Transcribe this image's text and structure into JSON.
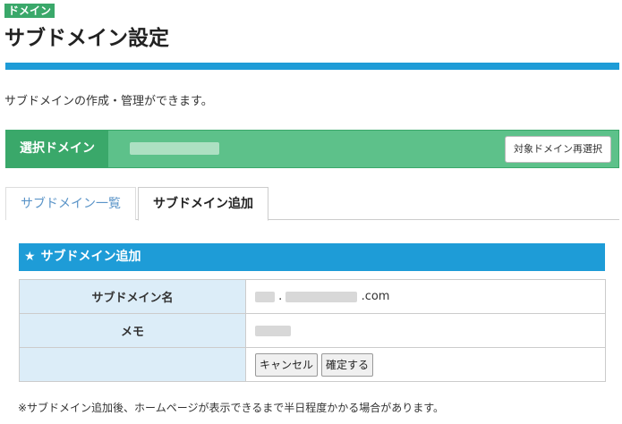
{
  "category_badge": "ドメイン",
  "page_title": "サブドメイン設定",
  "description": "サブドメインの作成・管理ができます。",
  "selected_domain": {
    "label": "選択ドメイン",
    "reselect_button": "対象ドメイン再選択"
  },
  "tabs": [
    {
      "label": "サブドメイン一覧",
      "active": false
    },
    {
      "label": "サブドメイン追加",
      "active": true
    }
  ],
  "section": {
    "icon": "star-icon",
    "title": "サブドメイン追加"
  },
  "form": {
    "subdomain_label": "サブドメイン名",
    "subdomain_suffix": ".com",
    "memo_label": "メモ",
    "cancel_button": "キャンセル",
    "confirm_button": "確定する"
  },
  "note": "※サブドメイン追加後、ホームページが表示できるまで半日程度かかる場合があります。",
  "colors": {
    "accent_blue": "#1e9cd7",
    "green": "#3aa86a",
    "green_light": "#5dc18a",
    "table_header_bg": "#dcedf8"
  }
}
